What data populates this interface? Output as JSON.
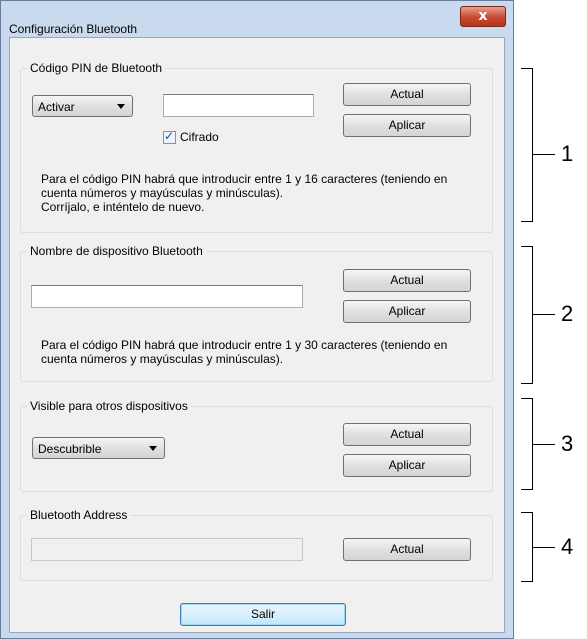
{
  "window": {
    "title": "Configuración Bluetooth",
    "close_label": "x"
  },
  "pin_group": {
    "label": "Código PIN de Bluetooth",
    "mode_select": "Activar",
    "pin_value": "",
    "update_label": "Actual",
    "apply_label": "Aplicar",
    "checkbox_label": "Cifrado",
    "checkbox_checked": true,
    "note_lines": [
      "Para el código PIN habrá que introducir entre 1 y 16 caracteres (teniendo en",
      "cuenta números y mayúsculas y minúsculas).",
      "Corríjalo, e inténtelo de nuevo."
    ]
  },
  "name_group": {
    "label": "Nombre de dispositivo Bluetooth",
    "name_value": "",
    "update_label": "Actual",
    "apply_label": "Aplicar",
    "note_lines": [
      "Para el código PIN habrá que introducir entre 1 y 30 caracteres (teniendo en",
      "cuenta números y mayúsculas y minúsculas)."
    ]
  },
  "visible_group": {
    "label": "Visible para otros dispositivos",
    "visibility_select": "Descubrible",
    "update_label": "Actual",
    "apply_label": "Aplicar"
  },
  "address_group": {
    "label": "Bluetooth Address",
    "address_value": "",
    "update_label": "Actual"
  },
  "exit_label": "Salir",
  "callouts": [
    "1",
    "2",
    "3",
    "4"
  ]
}
